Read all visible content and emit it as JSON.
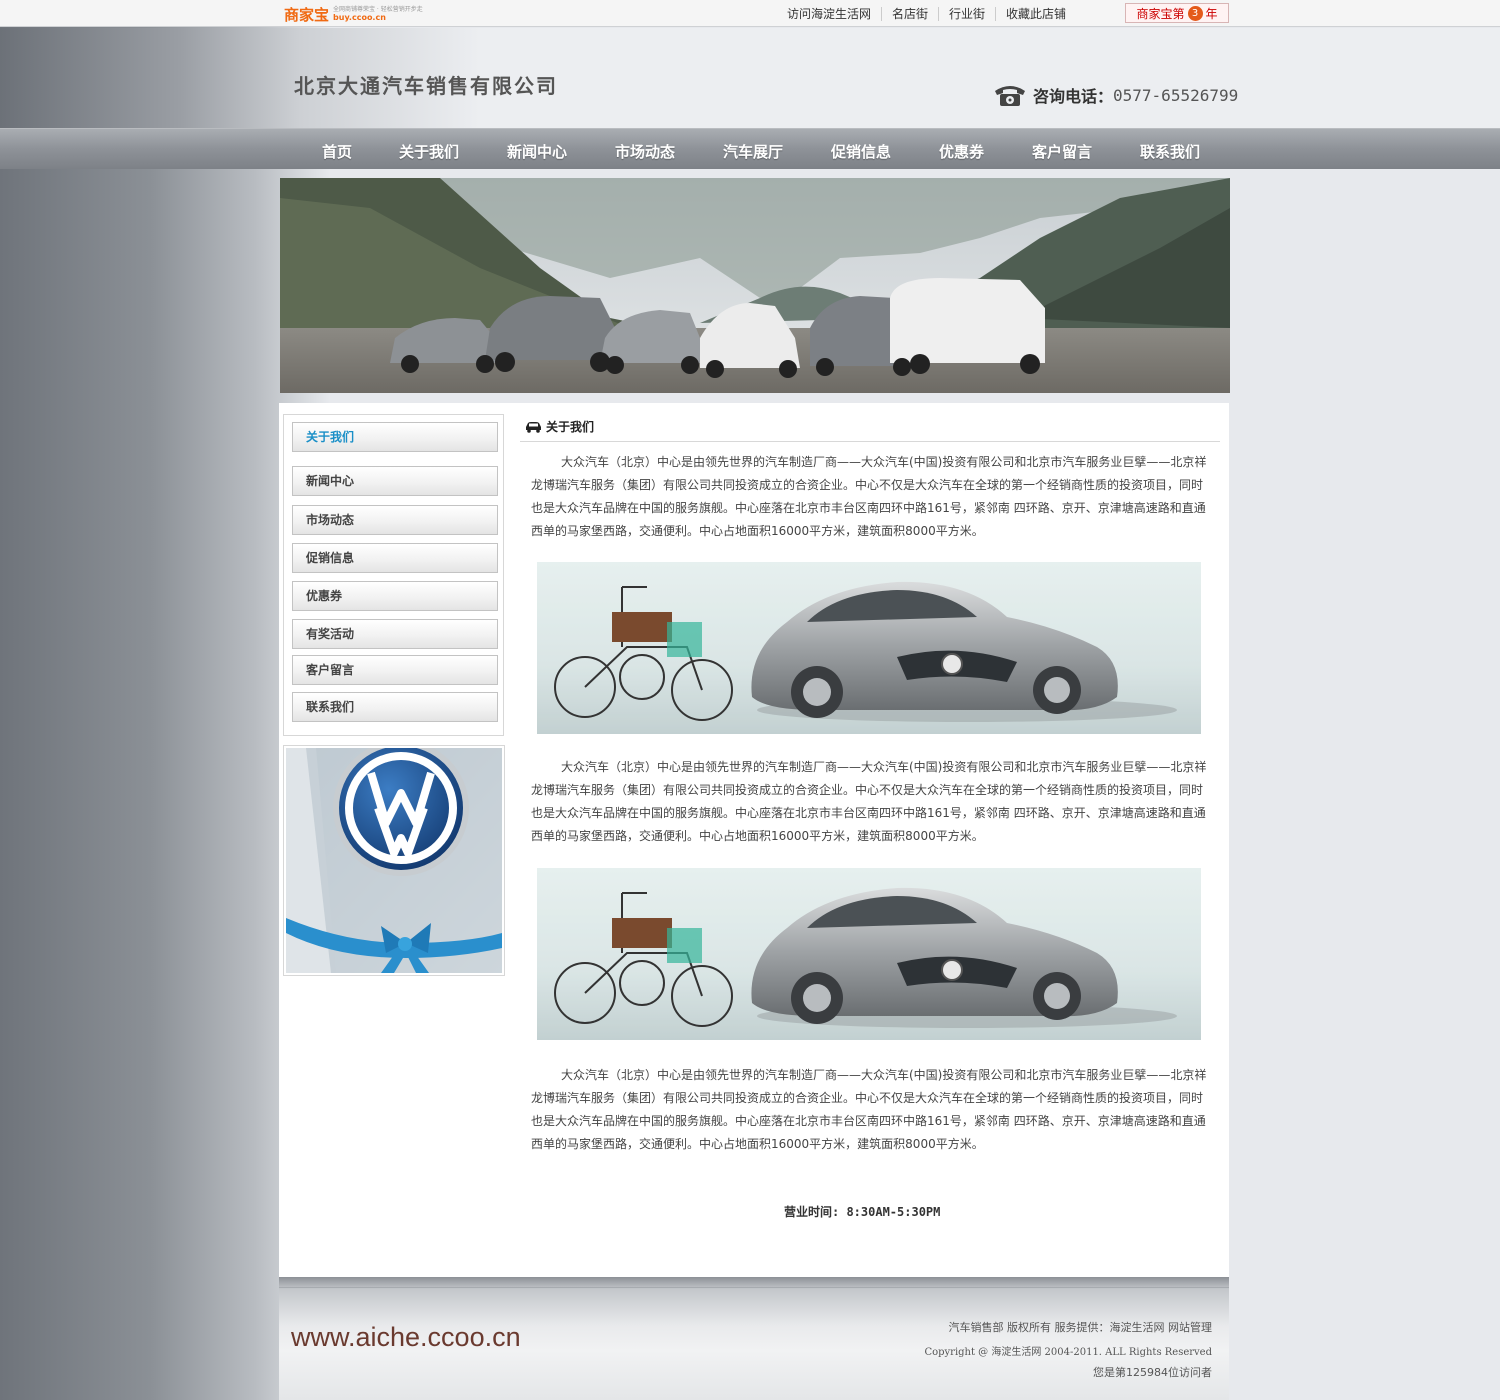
{
  "topbar": {
    "logo_main": "商家宝",
    "logo_tag": "全网商铺尊荣宝 · 轻松营销开步走",
    "logo_domain": "buy.ccoo.cn",
    "links": [
      "访问海淀生活网",
      "名店街",
      "行业街",
      "收藏此店铺"
    ],
    "badge_prefix": "商家宝第",
    "badge_num": "3",
    "badge_suffix": "年"
  },
  "header": {
    "company_name": "北京大通汽车销售有限公司",
    "phone_label": "咨询电话：",
    "phone_number": "0577-65526799"
  },
  "nav": {
    "items": [
      "首页",
      "关于我们",
      "新闻中心",
      "市场动态",
      "汽车展厅",
      "促销信息",
      "优惠券",
      "客户留言",
      "联系我们"
    ]
  },
  "sidebar": {
    "items": [
      "关于我们",
      "新闻中心",
      "市场动态",
      "促销信息",
      "优惠券",
      "有奖活动",
      "客户留言",
      "联系我们"
    ],
    "active_index": 0
  },
  "main": {
    "section_title": "关于我们",
    "paragraphs": [
      "大众汽车（北京）中心是由领先世界的汽车制造厂商——大众汽车(中国)投资有限公司和北京市汽车服务业巨擘——北京祥龙博瑞汽车服务（集团）有限公司共同投资成立的合资企业。中心不仅是大众汽车在全球的第一个经销商性质的投资项目，同时也是大众汽车品牌在中国的服务旗舰。中心座落在北京市丰台区南四环中路161号，紧邻南 四环路、京开、京津塘高速路和直通西单的马家堡西路，交通便利。中心占地面积16000平方米，建筑面积8000平方米。",
      "大众汽车（北京）中心是由领先世界的汽车制造厂商——大众汽车(中国)投资有限公司和北京市汽车服务业巨擘——北京祥龙博瑞汽车服务（集团）有限公司共同投资成立的合资企业。中心不仅是大众汽车在全球的第一个经销商性质的投资项目，同时也是大众汽车品牌在中国的服务旗舰。中心座落在北京市丰台区南四环中路161号，紧邻南 四环路、京开、京津塘高速路和直通西单的马家堡西路，交通便利。中心占地面积16000平方米，建筑面积8000平方米。",
      "大众汽车（北京）中心是由领先世界的汽车制造厂商——大众汽车(中国)投资有限公司和北京市汽车服务业巨擘——北京祥龙博瑞汽车服务（集团）有限公司共同投资成立的合资企业。中心不仅是大众汽车在全球的第一个经销商性质的投资项目，同时也是大众汽车品牌在中国的服务旗舰。中心座落在北京市丰台区南四环中路161号，紧邻南 四环路、京开、京津塘高速路和直通西单的马家堡西路，交通便利。中心占地面积16000平方米，建筑面积8000平方米。"
    ],
    "hours": "营业时间: 8:30AM-5:30PM"
  },
  "footer": {
    "domain": "www.aiche.ccoo.cn",
    "line1": "汽车销售部 版权所有 服务提供：海淀生活网 网站管理",
    "line2": "Copyright @ 海淀生活网 2004-2011. ALL Rights Reserved",
    "line3": "您是第125984位访问者"
  },
  "colors": {
    "logo_orange": "#f06a13",
    "active_link": "#1a8fc7",
    "badge_red": "#cc0000"
  }
}
